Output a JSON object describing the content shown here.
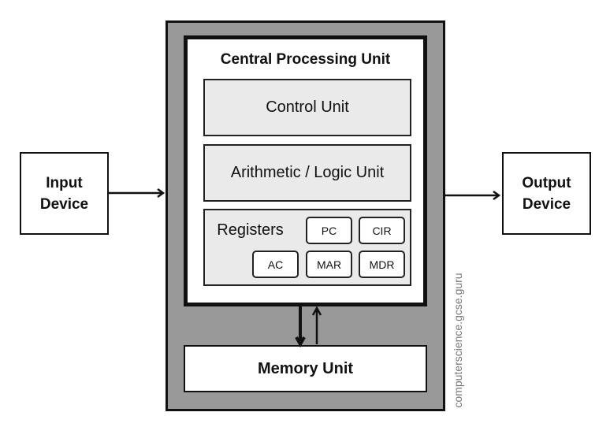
{
  "input_device": "Input\nDevice",
  "output_device": "Output\nDevice",
  "cpu": {
    "title": "Central Processing Unit",
    "control_unit": "Control Unit",
    "alu": "Arithmetic / Logic Unit",
    "registers": {
      "label": "Registers",
      "items": [
        "PC",
        "CIR",
        "AC",
        "MAR",
        "MDR"
      ]
    }
  },
  "memory_unit": "Memory Unit",
  "watermark": "computerscience.gcse.guru",
  "colors": {
    "outer": "#999999",
    "inner_units": "#eaeaea",
    "lines": "#111111"
  }
}
